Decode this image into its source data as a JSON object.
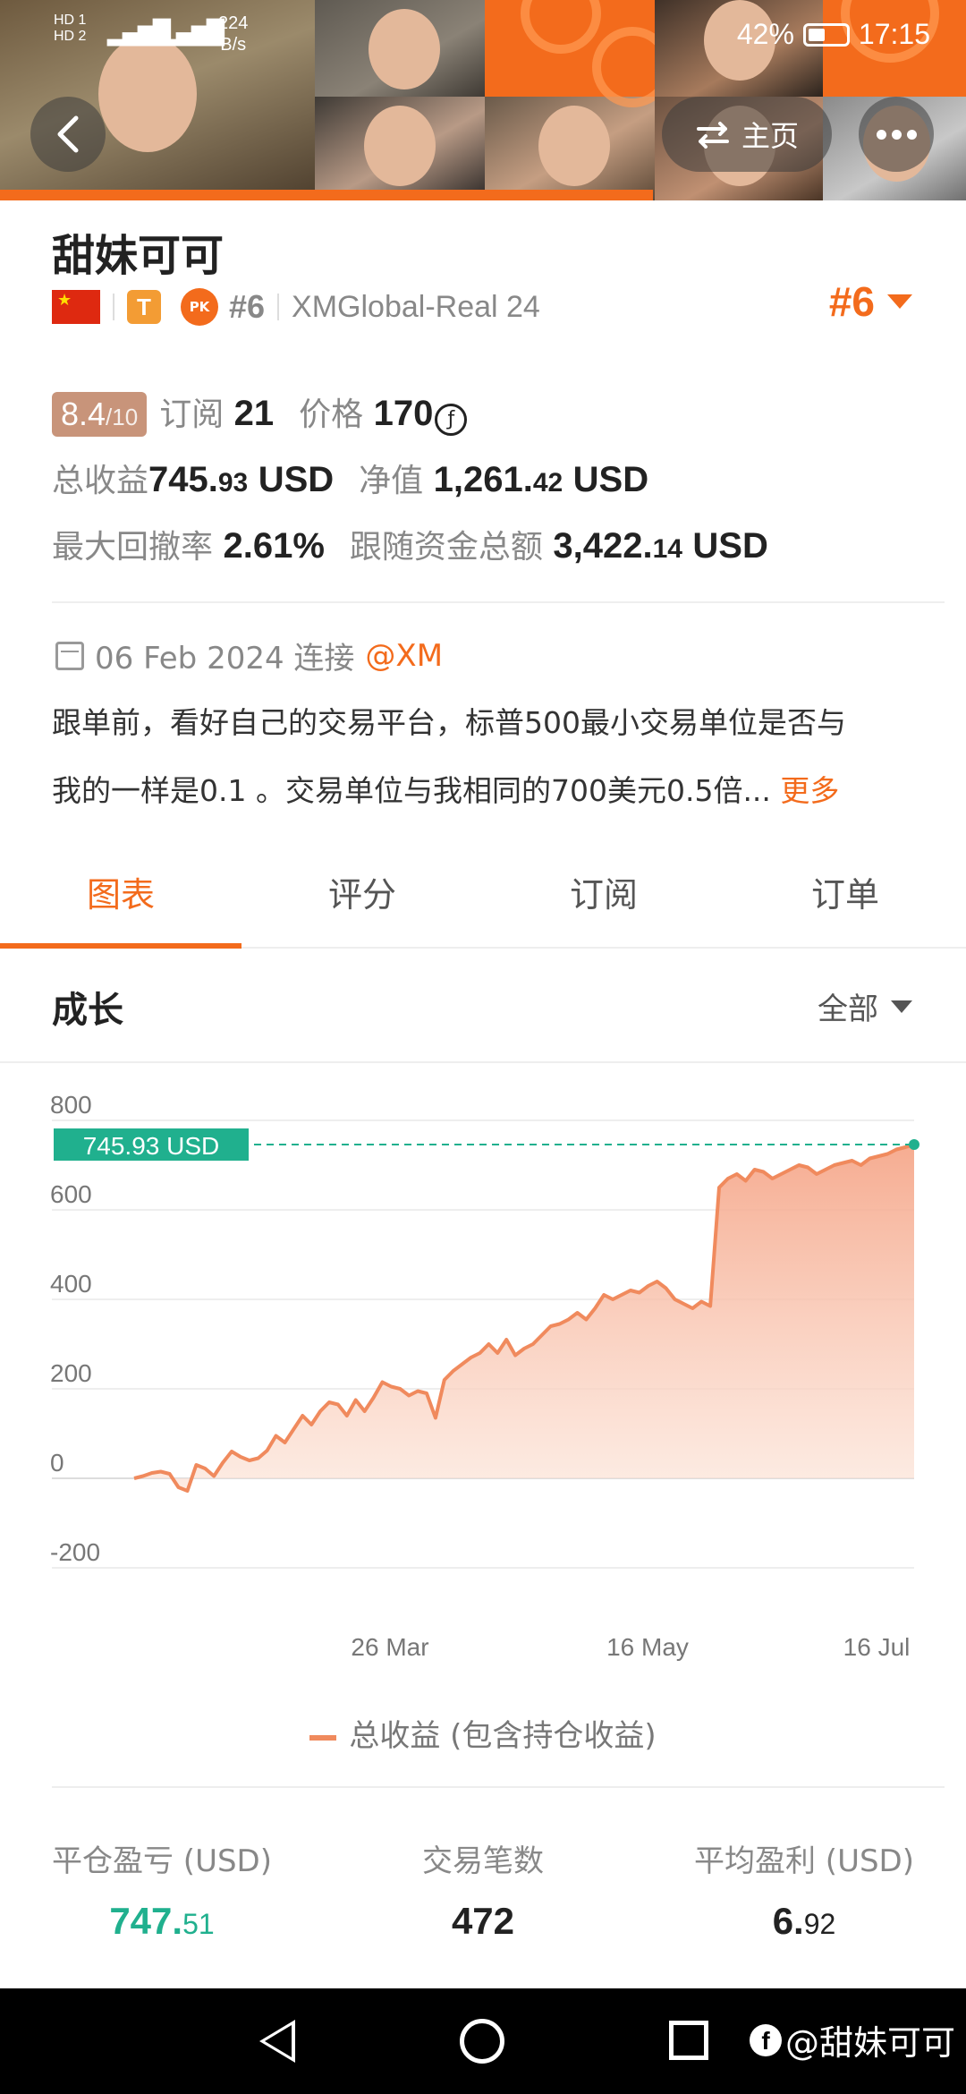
{
  "status_bar": {
    "network_left": "HD 1  HD 2",
    "speed_value": "224",
    "speed_unit": "B/s",
    "battery": "42%",
    "time": "17:15"
  },
  "header": {
    "home_label": "主页"
  },
  "profile": {
    "name": "甜妹可可",
    "t_badge": "T",
    "pk_badge": "PK",
    "rank_small": "#6",
    "server": "XMGlobal-Real 24",
    "rank_big": "#6"
  },
  "stats": {
    "score": "8.4",
    "score_max": "/10",
    "subscribe_label": "订阅",
    "subscribe_value": "21",
    "price_label": "价格",
    "price_value": "170",
    "price_currency_icon": "f-coin-icon",
    "total_profit_label": "总收益",
    "total_profit_int": "745.",
    "total_profit_dec": "93",
    "total_profit_unit": "USD",
    "equity_label": "净值",
    "equity_int": "1,261.",
    "equity_dec": "42",
    "equity_unit": "USD",
    "drawdown_label": "最大回撤率",
    "drawdown_value": "2.61%",
    "follow_label": "跟随资金总额",
    "follow_int": "3,422.",
    "follow_dec": "14",
    "follow_unit": "USD"
  },
  "info": {
    "date": "06 Feb 2024 连接",
    "broker": "@XM",
    "description_line1": "跟单前，看好自己的交易平台，标普500最小交易单位是否与",
    "description_line2": "我的一样是0.1 。交易单位与我相同的700美元0.5倍...",
    "more": "更多"
  },
  "tabs": [
    "图表",
    "评分",
    "订阅",
    "订单"
  ],
  "growth": {
    "title": "成长",
    "filter": "全部"
  },
  "chart_data": {
    "type": "area",
    "title": "",
    "xlabel": "",
    "ylabel": "",
    "ylim": [
      -200,
      800
    ],
    "yticks": [
      "800",
      "600",
      "400",
      "200",
      "0",
      "-200"
    ],
    "xtick_labels": [
      "26 Mar",
      "16 May",
      "16 Jul"
    ],
    "current_label": "745.93 USD",
    "current_value": 745.93,
    "series": [
      {
        "name": "总收益 (包含持仓收益)",
        "color": "#f08a5d",
        "values": [
          0,
          5,
          12,
          15,
          10,
          -20,
          -28,
          30,
          22,
          5,
          35,
          60,
          48,
          40,
          45,
          62,
          95,
          80,
          110,
          140,
          120,
          150,
          170,
          165,
          140,
          175,
          150,
          180,
          215,
          205,
          200,
          185,
          195,
          190,
          135,
          220,
          240,
          255,
          270,
          280,
          300,
          280,
          310,
          275,
          290,
          300,
          320,
          340,
          345,
          355,
          370,
          355,
          380,
          410,
          400,
          410,
          420,
          415,
          430,
          440,
          425,
          400,
          390,
          380,
          395,
          385,
          650,
          670,
          680,
          665,
          690,
          685,
          670,
          680,
          690,
          700,
          695,
          680,
          690,
          700,
          705,
          710,
          700,
          715,
          720,
          725,
          735,
          740,
          745.93
        ]
      }
    ],
    "legend": "总收益 (包含持仓收益)",
    "grid": true
  },
  "kpis": [
    {
      "label": "平仓盈亏 (USD)",
      "int": "747.",
      "dec": "51",
      "color": "green"
    },
    {
      "label": "交易笔数",
      "int": "472",
      "dec": "",
      "color": "default"
    },
    {
      "label": "平均盈利 (USD)",
      "int": "6.",
      "dec": "92",
      "color": "default"
    }
  ],
  "watermark": "@甜妹可可"
}
